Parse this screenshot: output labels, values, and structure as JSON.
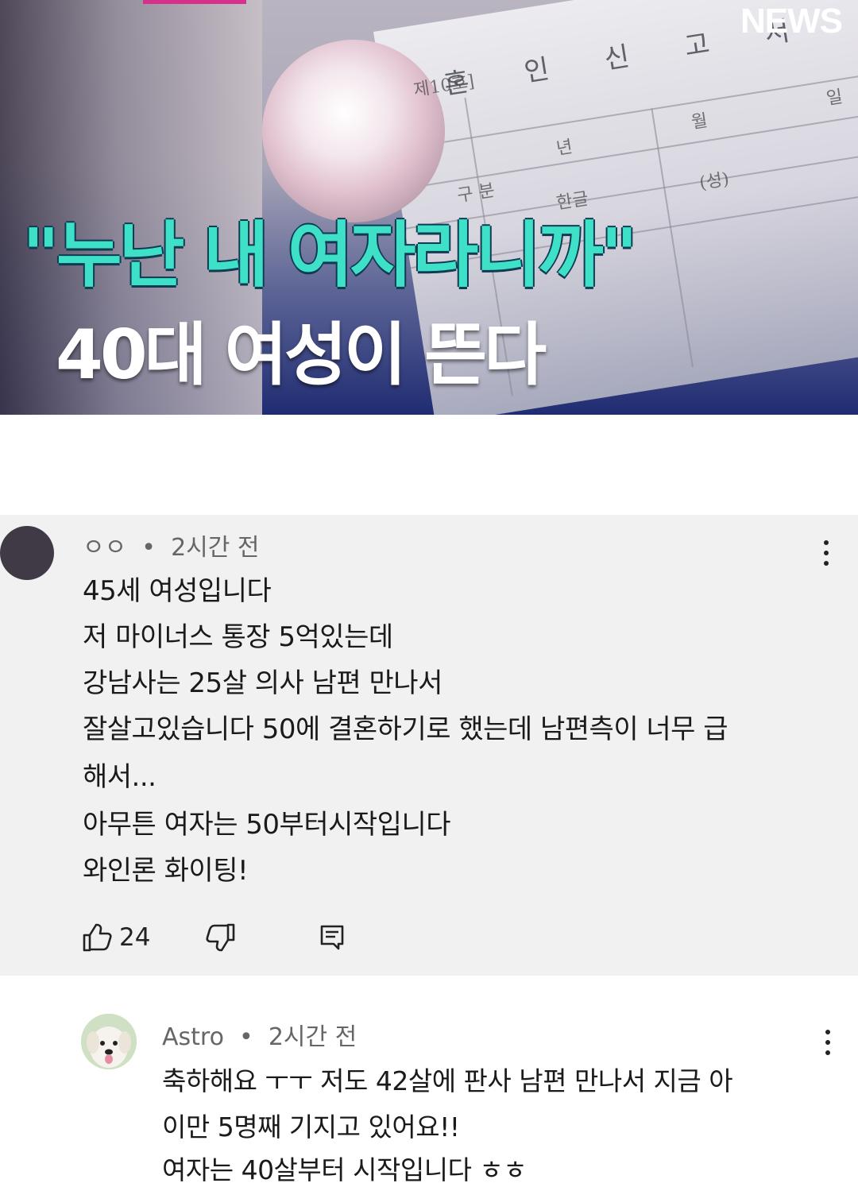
{
  "thumbnail": {
    "logo": "NEWS",
    "headline_line1": "\"누난 내 여자라니까\"",
    "headline_line2": "40대 여성이 뜬다",
    "document": {
      "number": "제10호]",
      "title": "혼 인 신 고 서",
      "date_fields": [
        "년",
        "월",
        "일"
      ],
      "row_label": "구 분",
      "row_label2": "한글",
      "name_field": "(성)"
    }
  },
  "comments": [
    {
      "author": "ㅇㅇ",
      "time": "2시간 전",
      "lines": [
        "45세 여성입니다",
        "저 마이너스 통장 5억있는데",
        "강남사는 25살 의사 남편 만나서",
        "잘살고있습니다 50에 결혼하기로 했는데 남편측이 너무 급",
        "해서...",
        "아무튼 여자는 50부터시작입니다",
        "와인론 화이팅!"
      ],
      "likes": "24",
      "icons": [
        "like-icon",
        "dislike-icon",
        "reply-icon",
        "more-vert-icon"
      ]
    },
    {
      "author": "Astro",
      "time": "2시간 전",
      "lines": [
        "축하해요 ㅜㅜ 저도  42살에 판사 남편 만나서 지금 아",
        "이만 5명째 기지고 있어요!!",
        "여자는 40살부터 시작입니다 ㅎㅎ"
      ],
      "icons": [
        "dog-avatar",
        "more-vert-icon"
      ]
    }
  ],
  "colors": {
    "headline_accent": "#3ee0c8",
    "comment_bg": "#f1f1f1",
    "thumbnail_bottom": "#202c72"
  }
}
